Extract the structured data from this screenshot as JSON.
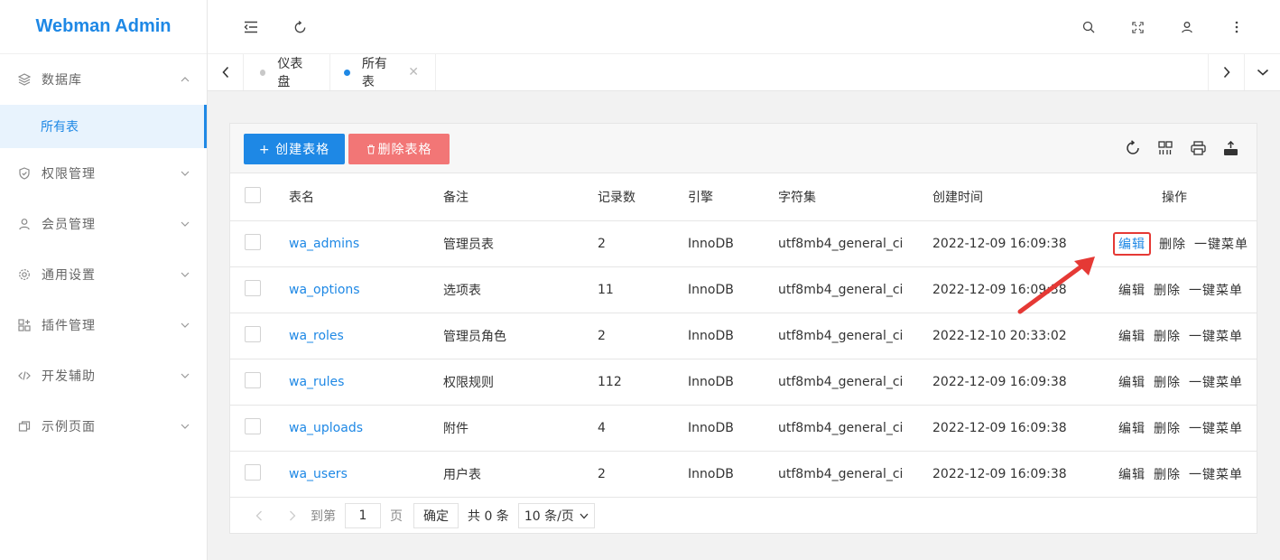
{
  "app": {
    "title": "Webman Admin"
  },
  "sidebar": {
    "items": [
      {
        "label": "数据库",
        "icon": "layers-icon",
        "expanded": true,
        "children": [
          {
            "label": "所有表",
            "active": true
          }
        ]
      },
      {
        "label": "权限管理",
        "icon": "shield-icon"
      },
      {
        "label": "会员管理",
        "icon": "user-icon"
      },
      {
        "label": "通用设置",
        "icon": "gear-icon"
      },
      {
        "label": "插件管理",
        "icon": "grid-plus-icon"
      },
      {
        "label": "开发辅助",
        "icon": "code-icon"
      },
      {
        "label": "示例页面",
        "icon": "pages-icon"
      }
    ]
  },
  "header": {
    "icons": [
      "menu-collapse-icon",
      "refresh-icon",
      "search-icon",
      "fullscreen-icon",
      "user-icon",
      "more-vertical-icon"
    ]
  },
  "tabs": [
    {
      "label": "仪表盘",
      "active": false,
      "dot_color": "#c8c8c8"
    },
    {
      "label": "所有表",
      "active": true,
      "dot_color": "#1e88e5",
      "closable": true
    }
  ],
  "toolbar": {
    "create_label": "+ 创建表格",
    "delete_label": "删除表格",
    "icons": [
      "refresh-icon",
      "columns-icon",
      "print-icon",
      "export-icon"
    ]
  },
  "table": {
    "headers": [
      "表名",
      "备注",
      "记录数",
      "引擎",
      "字符集",
      "创建时间",
      "操作"
    ],
    "rows": [
      {
        "name": "wa_admins",
        "comment": "管理员表",
        "records": "2",
        "engine": "InnoDB",
        "charset": "utf8mb4_general_ci",
        "created": "2022-12-09 16:09:38"
      },
      {
        "name": "wa_options",
        "comment": "选项表",
        "records": "11",
        "engine": "InnoDB",
        "charset": "utf8mb4_general_ci",
        "created": "2022-12-09 16:09:38"
      },
      {
        "name": "wa_roles",
        "comment": "管理员角色",
        "records": "2",
        "engine": "InnoDB",
        "charset": "utf8mb4_general_ci",
        "created": "2022-12-10 20:33:02"
      },
      {
        "name": "wa_rules",
        "comment": "权限规则",
        "records": "112",
        "engine": "InnoDB",
        "charset": "utf8mb4_general_ci",
        "created": "2022-12-09 16:09:38"
      },
      {
        "name": "wa_uploads",
        "comment": "附件",
        "records": "4",
        "engine": "InnoDB",
        "charset": "utf8mb4_general_ci",
        "created": "2022-12-09 16:09:38"
      },
      {
        "name": "wa_users",
        "comment": "用户表",
        "records": "2",
        "engine": "InnoDB",
        "charset": "utf8mb4_general_ci",
        "created": "2022-12-09 16:09:38"
      }
    ],
    "actions": {
      "edit": "编辑",
      "delete": "删除",
      "menu": "一键菜单"
    }
  },
  "pager": {
    "goto_label": "到第",
    "page_value": "1",
    "page_unit": "页",
    "confirm_label": "确定",
    "total_label": "共 0 条",
    "per_page": "10 条/页"
  },
  "colors": {
    "accent": "#1e88e5",
    "danger": "#f27676",
    "highlight": "#e53935"
  }
}
